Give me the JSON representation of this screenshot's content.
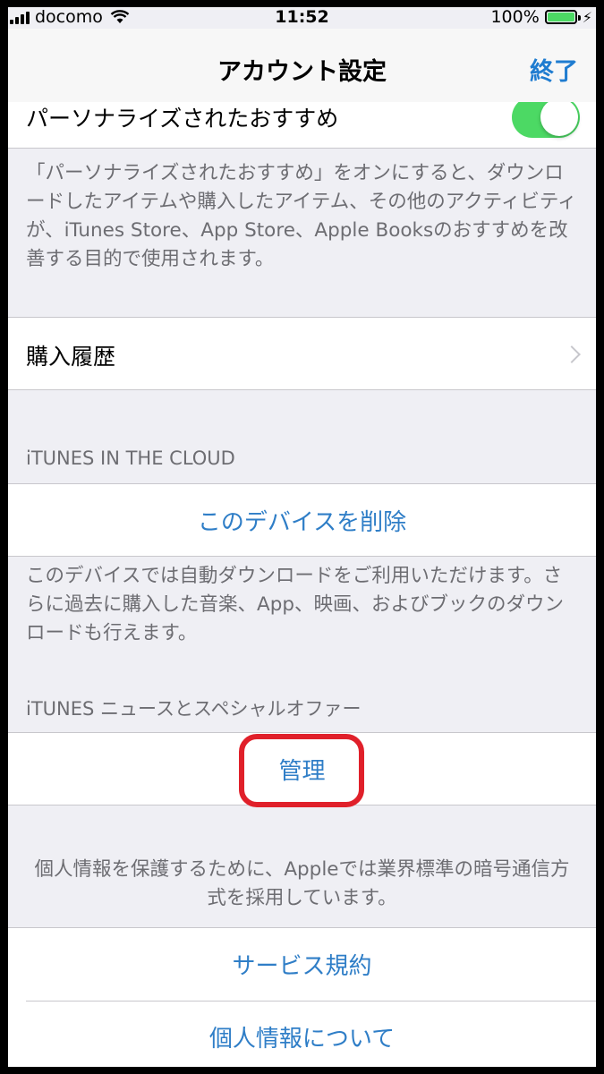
{
  "status_bar": {
    "carrier": "docomo",
    "time": "11:52",
    "battery_percent": "100%",
    "signal_icon": "signal-bars-icon",
    "wifi_icon": "wifi-icon",
    "battery_icon": "battery-full-icon",
    "charging_icon": "charging-plug-icon"
  },
  "nav": {
    "title": "アカウント設定",
    "done_label": "終了"
  },
  "personalized": {
    "label": "パーソナライズされたおすすめ",
    "toggle_on": true,
    "description": "「パーソナライズされたおすすめ」をオンにすると、ダウンロードしたアイテムや購入したアイテム、その他のアクティビティが、iTunes Store、App Store、Apple Booksのおすすめを改善する目的で使用されます。"
  },
  "purchase_history": {
    "label": "購入履歴"
  },
  "itunes_cloud": {
    "header": "iTUNES IN THE CLOUD",
    "remove_device_label": "このデバイスを削除",
    "footer": "このデバイスでは自動ダウンロードをご利用いただけます。さらに過去に購入した音楽、App、映画、およびブックのダウンロードも行えます。"
  },
  "itunes_news": {
    "header": "iTUNES ニュースとスペシャルオファー",
    "manage_label": "管理"
  },
  "privacy": {
    "note": "個人情報を保護するために、Appleでは業界標準の暗号通信方式を採用しています。",
    "terms_label": "サービス規約",
    "privacy_label": "個人情報について"
  },
  "colors": {
    "accent": "#2f7ec7",
    "toggle_on": "#4cd964",
    "highlight": "#e0202a",
    "background": "#efeff4"
  }
}
